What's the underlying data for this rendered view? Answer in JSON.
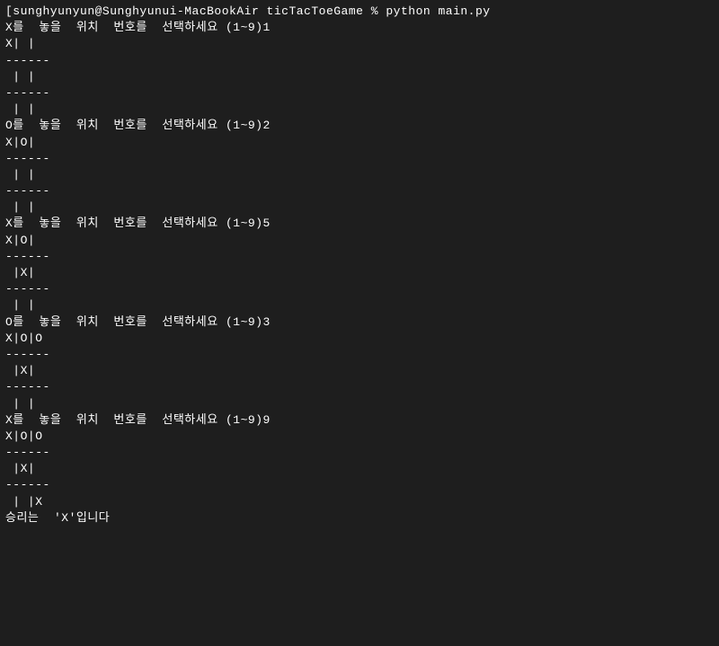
{
  "terminal": {
    "lines": [
      "[sunghyunyun@Sunghyunui-MacBookAir ticTacToeGame % python main.py",
      "X를  놓을  위치  번호를  선택하세요 (1~9)1",
      "X| |",
      "------",
      " | |",
      "------",
      " | |",
      "O를  놓을  위치  번호를  선택하세요 (1~9)2",
      "X|O|",
      "------",
      " | |",
      "------",
      " | |",
      "X를  놓을  위치  번호를  선택하세요 (1~9)5",
      "X|O|",
      "------",
      " |X|",
      "------",
      " | |",
      "O를  놓을  위치  번호를  선택하세요 (1~9)3",
      "X|O|O",
      "------",
      " |X|",
      "------",
      " | |",
      "X를  놓을  위치  번호를  선택하세요 (1~9)9",
      "X|O|O",
      "------",
      " |X|",
      "------",
      " | |X",
      "승리는  'X'입니다"
    ]
  }
}
